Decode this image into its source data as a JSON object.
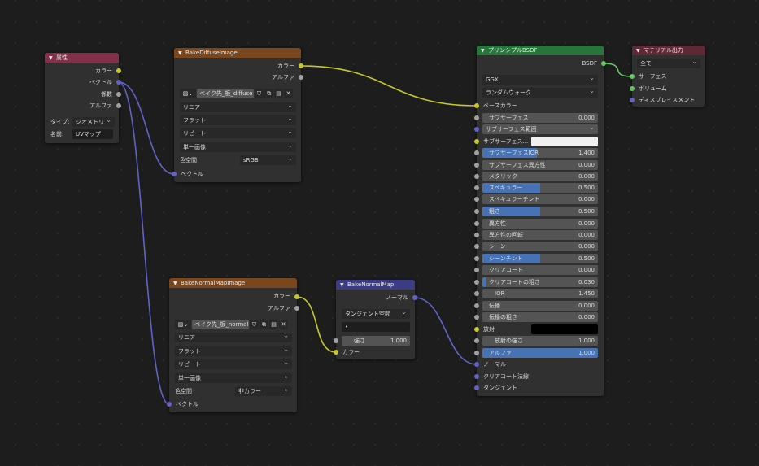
{
  "nodes": {
    "attribute": {
      "title": "属性",
      "outputs": [
        "カラー",
        "ベクトル",
        "係数",
        "アルファ"
      ],
      "type_label": "タイプ:",
      "type_value": "ジオメトリ",
      "name_label": "名前:",
      "name_value": "UVマップ"
    },
    "diffuse_image": {
      "title": "BakeDiffuseImage",
      "outputs": [
        "カラー",
        "アルファ"
      ],
      "image_name": "ベイク先_板_diffuse",
      "interpolation": "リニア",
      "projection": "フラット",
      "extension": "リピート",
      "source": "単一画像",
      "colorspace_label": "色空間",
      "colorspace_value": "sRGB",
      "input": "ベクトル"
    },
    "normal_image": {
      "title": "BakeNormalMapImage",
      "outputs": [
        "カラー",
        "アルファ"
      ],
      "image_name": "ベイク先_板_normal",
      "interpolation": "リニア",
      "projection": "フラット",
      "extension": "リピート",
      "source": "単一画像",
      "colorspace_label": "色空間",
      "colorspace_value": "非カラー",
      "input": "ベクトル"
    },
    "normal_map": {
      "title": "BakeNormalMap",
      "output": "ノーマル",
      "space": "タンジェント空間",
      "uv_value": "•",
      "strength_label": "強さ",
      "strength_value": "1.000",
      "strength_fraction": 0,
      "color_input": "カラー"
    },
    "bsdf": {
      "title": "プリンシプルBSDF",
      "output": "BSDF",
      "distribution": "GGX",
      "subsurface_method": "ランダムウォーク",
      "base_color": "ベースカラー",
      "subsurface": {
        "label": "サブサーフェス",
        "value": "0.000",
        "fraction": 0
      },
      "subsurface_radius": "サブサーフェス範囲",
      "subsurface_color": "サブサーフェス...",
      "subsurface_ior": {
        "label": "サブサーフェスIOR",
        "value": "1.400",
        "fraction": 0.47
      },
      "subsurface_aniso": {
        "label": "サブサーフェス異方性",
        "value": "0.000",
        "fraction": 0
      },
      "metallic": {
        "label": "メタリック",
        "value": "0.000",
        "fraction": 0
      },
      "specular": {
        "label": "スペキュラー",
        "value": "0.500",
        "fraction": 0.5
      },
      "specular_tint": {
        "label": "スペキュラーチント",
        "value": "0.000",
        "fraction": 0
      },
      "roughness": {
        "label": "粗さ",
        "value": "0.500",
        "fraction": 0.5
      },
      "anisotropic": {
        "label": "異方性",
        "value": "0.000",
        "fraction": 0
      },
      "aniso_rotation": {
        "label": "異方性の回転",
        "value": "0.000",
        "fraction": 0
      },
      "sheen": {
        "label": "シーン",
        "value": "0.000",
        "fraction": 0
      },
      "sheen_tint": {
        "label": "シーンチント",
        "value": "0.500",
        "fraction": 0.5
      },
      "clearcoat": {
        "label": "クリアコート",
        "value": "0.000",
        "fraction": 0
      },
      "clearcoat_rough": {
        "label": "クリアコートの粗さ",
        "value": "0.030",
        "fraction": 0.03
      },
      "ior": {
        "label": "IOR",
        "value": "1.450"
      },
      "transmission": {
        "label": "伝播",
        "value": "0.000",
        "fraction": 0
      },
      "transmission_rough": {
        "label": "伝播の粗さ",
        "value": "0.000",
        "fraction": 0
      },
      "emission": "放射",
      "emission_strength": {
        "label": "放射の強さ",
        "value": "1.000"
      },
      "alpha": {
        "label": "アルファ",
        "value": "1.000",
        "fraction": 1
      },
      "normal": "ノーマル",
      "clearcoat_normal": "クリアコート法線",
      "tangent": "タンジェント"
    },
    "output": {
      "title": "マテリアル出力",
      "target": "全て",
      "inputs": [
        "サーフェス",
        "ボリューム",
        "ディスプレイスメント"
      ]
    }
  },
  "colors": {
    "socket_color": "#c7c729",
    "socket_float": "#a1a1a1",
    "socket_vector": "#6363c7",
    "socket_shader": "#63c763",
    "value_fill": "#4772b3"
  }
}
